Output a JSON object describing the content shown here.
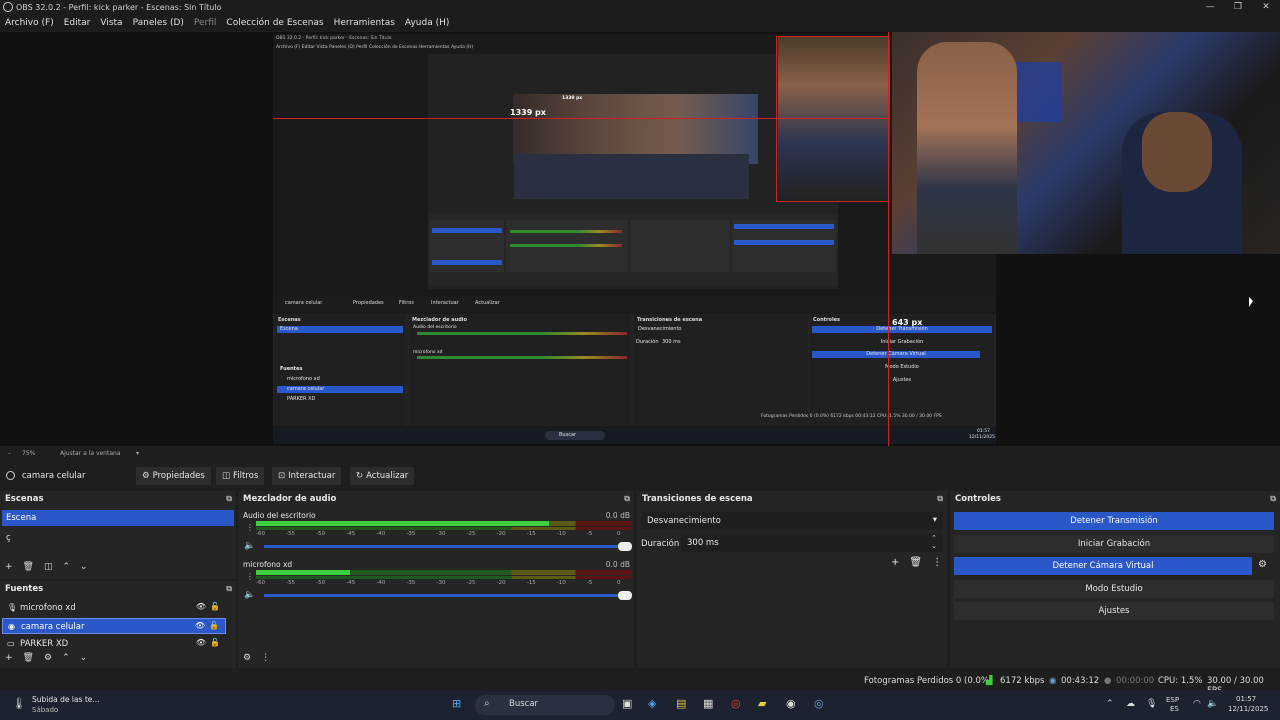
{
  "window": {
    "title": "OBS 32.0.2 - Perfil: kick parker - Escenas: Sin Título",
    "controls": [
      "—",
      "❐",
      "✕"
    ]
  },
  "menu": {
    "items": [
      "Archivo (F)",
      "Editar",
      "Vista",
      "Paneles (D)",
      "Perfil",
      "Colección de Escenas",
      "Herramientas",
      "Ayuda (H)"
    ]
  },
  "preview": {
    "nested_title": "OBS 32.0.2 - Perfil: kick parker - Escenas: Sin Título",
    "nested_menu": "Archivo (F)   Editar   Vista   Paneles (D)   Perfil   Colección de Escenas   Herramientas   Ayuda (H)",
    "measure_width": "1339 px",
    "measure_inner": "1339 px",
    "measure_height": "643 px",
    "nested_source": "camara celular",
    "nested_buttons": [
      "Propiedades",
      "Filtros",
      "Interactuar",
      "Actualizar"
    ],
    "nested_docks": [
      "Escenas",
      "Mezclador de audio",
      "Transiciones de escena",
      "Controles"
    ],
    "nested_scene": "Escena",
    "nested_sources": [
      "microfono xd",
      "camara celular",
      "PARKER XD"
    ],
    "nested_tracks": [
      "Audio del escritorio",
      "microfono xd"
    ],
    "nested_transition": "Desvanecimiento",
    "nested_duration_label": "Duración",
    "nested_duration": "300 ms",
    "nested_controls": [
      "Detener Transmisión",
      "Iniciar Grabación",
      "Detener Cámara Virtual",
      "Modo Estudio",
      "Ajustes"
    ],
    "nested_status": "Fotogramas Perdidos 0 (0.0%)   6172 kbps   00:43:12   CPU: 1.5%   30.00 / 30.00 FPS",
    "nested_search": "Buscar",
    "nested_zoom": "Ajustar a la ventana",
    "nested_clock": "01:57",
    "nested_date": "12/11/2025"
  },
  "zoom": {
    "value": "75%",
    "fit": "Ajustar a la ventana"
  },
  "source_toolbar": {
    "source_name": "camara celular",
    "buttons": [
      {
        "icon": "gear-icon",
        "label": "Propiedades"
      },
      {
        "icon": "filter-icon",
        "label": "Filtros"
      },
      {
        "icon": "pointer-icon",
        "label": "Interactuar"
      },
      {
        "icon": "refresh-icon",
        "label": "Actualizar"
      }
    ]
  },
  "scenes": {
    "title": "Escenas",
    "items": [
      "Escena",
      "ç"
    ],
    "selected": 0
  },
  "sources": {
    "title": "Fuentes",
    "items": [
      {
        "name": "microfono xd",
        "icon": "mic-icon"
      },
      {
        "name": "camara celular",
        "icon": "camera-icon"
      },
      {
        "name": "PARKER XD",
        "icon": "display-icon"
      }
    ],
    "selected": 1
  },
  "mixer": {
    "title": "Mezclador de audio",
    "tracks": [
      {
        "name": "Audio del escritorio",
        "db": "0.0 dB",
        "level": 0.78,
        "volume": 1.0
      },
      {
        "name": "microfono xd",
        "db": "0.0 dB",
        "level": 0.25,
        "volume": 1.0
      }
    ],
    "ticks": [
      "-60",
      "-55",
      "-50",
      "-45",
      "-40",
      "-35",
      "-30",
      "-25",
      "-20",
      "-15",
      "-10",
      "-5",
      "0"
    ]
  },
  "transitions": {
    "title": "Transiciones de escena",
    "selected": "Desvanecimiento",
    "duration_label": "Duración",
    "duration": "300 ms"
  },
  "controls": {
    "title": "Controles",
    "buttons": [
      {
        "label": "Detener Transmisión",
        "active": true
      },
      {
        "label": "Iniciar Grabación",
        "active": false
      },
      {
        "label": "Detener Cámara Virtual",
        "active": true
      },
      {
        "label": "Modo Estudio",
        "active": false
      },
      {
        "label": "Ajustes",
        "active": false
      }
    ]
  },
  "status": {
    "dropped": "Fotogramas Perdidos 0 (0.0%)",
    "bitrate": "6172 kbps",
    "stream_time": "00:43:12",
    "rec_time": "00:00:00",
    "cpu": "CPU: 1.5%",
    "fps": "30.00 / 30.00 FPS"
  },
  "taskbar": {
    "notification_title": "Subida de las te...",
    "notification_sub": "Sábado",
    "search": "Buscar",
    "lang": "ESP",
    "lang2": "ES",
    "time": "01:57",
    "date": "12/11/2025"
  },
  "colors": {
    "accent": "#2b58c8",
    "panel": "#252525",
    "background": "#1e1e1e",
    "measure_line": "#d42020"
  }
}
